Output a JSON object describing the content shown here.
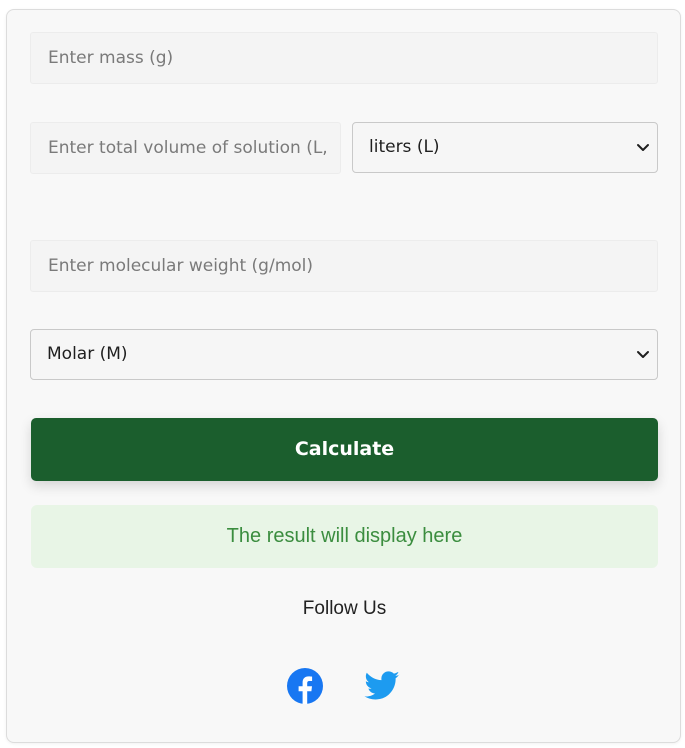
{
  "form": {
    "mass_placeholder": "Enter mass (g)",
    "volume_placeholder": "Enter total volume of solution (L,",
    "volume_unit_selected": "liters (L)",
    "mw_placeholder": "Enter molecular weight (g/mol)",
    "concentration_unit_selected": "Molar (M)",
    "calculate_label": "Calculate",
    "result_text": "The result will display here"
  },
  "social": {
    "heading": "Follow Us",
    "icons": [
      "facebook-icon",
      "twitter-icon"
    ]
  },
  "colors": {
    "button_bg": "#1b5e2d",
    "result_bg": "#e8f5e6",
    "result_text": "#3b8d3f",
    "facebook": "#1877f2",
    "twitter": "#1d9bf0"
  }
}
